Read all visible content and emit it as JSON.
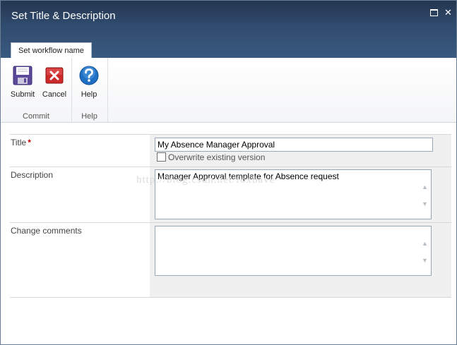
{
  "dialog": {
    "title": "Set Title & Description",
    "maximize_glyph": "",
    "close_glyph": "✕"
  },
  "ribbon": {
    "tab_label": "Set workflow name",
    "groups": {
      "commit_label": "Commit",
      "help_label": "Help"
    },
    "buttons": {
      "submit": "Submit",
      "cancel": "Cancel",
      "help": "Help"
    },
    "icons": {
      "submit": "floppy-disk-icon",
      "cancel": "red-x-icon",
      "help": "question-mark-icon"
    }
  },
  "form": {
    "title_label": "Title",
    "required_marker": "*",
    "title_value": "My Absence Manager Approval",
    "overwrite_label": "Overwrite existing version",
    "overwrite_checked": false,
    "description_label": "Description",
    "description_value": "Manager Approval template for Absence request",
    "comments_label": "Change comments",
    "comments_value": ""
  },
  "watermark": "http://blog.csdn.net/foxbave",
  "colors": {
    "titlebar": "#2f4a6c",
    "required": "#cc0000",
    "field_bg": "#f0f0f0"
  }
}
